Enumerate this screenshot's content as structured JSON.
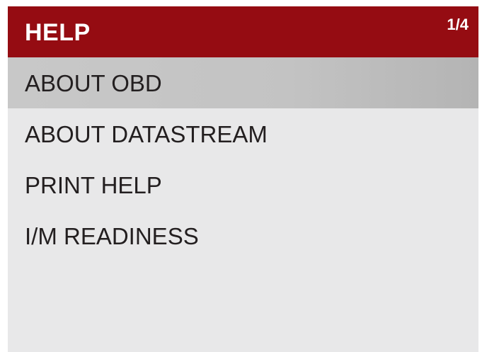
{
  "header": {
    "title": "HELP",
    "page_indicator": "1/4"
  },
  "menu": {
    "selected_index": 0,
    "items": [
      {
        "label": "ABOUT OBD"
      },
      {
        "label": "ABOUT DATASTREAM"
      },
      {
        "label": "PRINT HELP"
      },
      {
        "label": "I/M READINESS"
      }
    ]
  },
  "colors": {
    "header_background": "#950c12",
    "header_text": "#ffffff",
    "screen_background": "#e8e8e9",
    "selected_row": "#c3c3c3",
    "item_text": "#231f20"
  }
}
